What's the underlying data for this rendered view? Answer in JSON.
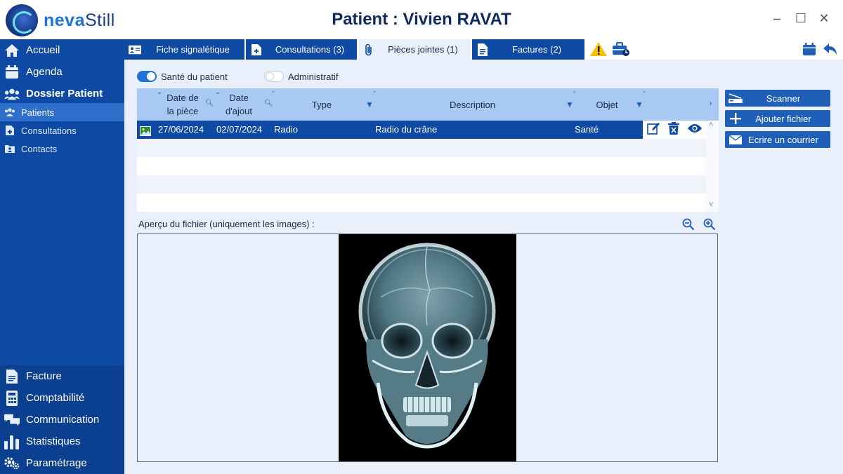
{
  "app": {
    "logo_part1": "neva",
    "logo_part2": "Still",
    "title": "Patient : Vivien RAVAT"
  },
  "window_controls": {
    "minimize": "–",
    "maximize": "☐",
    "close": "✕"
  },
  "sidebar": {
    "items": [
      {
        "label": "Accueil",
        "icon": "home-icon"
      },
      {
        "label": "Agenda",
        "icon": "calendar-icon"
      },
      {
        "label": "Dossier Patient",
        "icon": "patients-group-icon"
      }
    ],
    "sub_items": [
      {
        "label": "Patients",
        "icon": "patients-icon",
        "active": true
      },
      {
        "label": "Consultations",
        "icon": "consultation-icon"
      },
      {
        "label": "Contacts",
        "icon": "contacts-icon"
      }
    ],
    "bottom_items": [
      {
        "label": "Facture",
        "icon": "invoice-icon"
      },
      {
        "label": "Comptabilité",
        "icon": "calculator-icon"
      },
      {
        "label": "Communication",
        "icon": "chat-icon"
      },
      {
        "label": "Statistiques",
        "icon": "bar-chart-icon"
      },
      {
        "label": "Paramétrage",
        "icon": "settings-icon"
      }
    ]
  },
  "tabs": [
    {
      "label": "Fiche signalétique",
      "icon": "id-card-icon"
    },
    {
      "label": "Consultations (3)",
      "icon": "medical-doc-icon"
    },
    {
      "label": "Pièces jointes (1)",
      "icon": "paperclip-icon",
      "active": true
    },
    {
      "label": "Factures (2)",
      "icon": "invoice-icon"
    }
  ],
  "filters": {
    "sante": {
      "label": "Santé du patient",
      "on": true
    },
    "admin": {
      "label": "Administratif",
      "on": false
    }
  },
  "table": {
    "headers": {
      "date_piece": "Date de la pièce",
      "date_ajout": "Date d'ajout",
      "type": "Type",
      "description": "Description",
      "objet": "Objet"
    },
    "rows": [
      {
        "date_piece": "27/06/2024",
        "date_ajout": "02/07/2024",
        "type": "Radio",
        "description": "Radio du crâne",
        "objet": "Santé"
      }
    ]
  },
  "buttons": {
    "scanner": "Scanner",
    "add_file": "Ajouter fichier",
    "write_letter": "Ecrire un courrier"
  },
  "preview": {
    "label": "Aperçu du fichier (uniquement les images) :"
  },
  "colors": {
    "sidebar": "#0e4aa3",
    "accent": "#1f73d6",
    "content_bg": "#e9f0fb",
    "header_bg": "#a7c9f2",
    "warning": "#f2c300"
  }
}
